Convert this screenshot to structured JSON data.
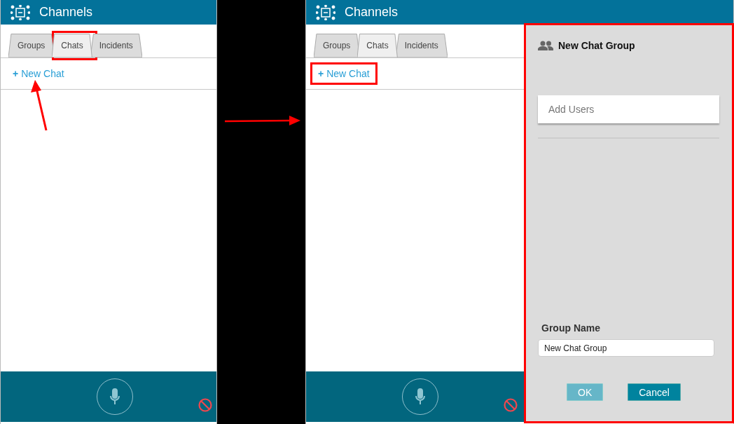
{
  "panels": [
    {
      "title": "Channels",
      "tabs": [
        {
          "label": "Groups",
          "selected": false,
          "highlighted": false
        },
        {
          "label": "Chats",
          "selected": true,
          "highlighted": true
        },
        {
          "label": "Incidents",
          "selected": false,
          "highlighted": false
        }
      ],
      "new_chat": {
        "icon": "+",
        "label": "New Chat",
        "highlighted": false
      },
      "annotation_arrow": true
    },
    {
      "title": "Channels",
      "tabs": [
        {
          "label": "Groups",
          "selected": false,
          "highlighted": false
        },
        {
          "label": "Chats",
          "selected": true,
          "highlighted": false
        },
        {
          "label": "Incidents",
          "selected": false,
          "highlighted": false
        }
      ],
      "new_chat": {
        "icon": "+",
        "label": "New Chat",
        "highlighted": true
      },
      "annotation_arrow": false
    }
  ],
  "dialog": {
    "title": "New Chat Group",
    "highlighted": true,
    "search": {
      "placeholder": "Add Users"
    },
    "group_name": {
      "label": "Group Name",
      "value": "New Chat Group"
    },
    "buttons": [
      {
        "label": "OK",
        "disabled": true
      },
      {
        "label": "Cancel",
        "disabled": false
      }
    ]
  }
}
